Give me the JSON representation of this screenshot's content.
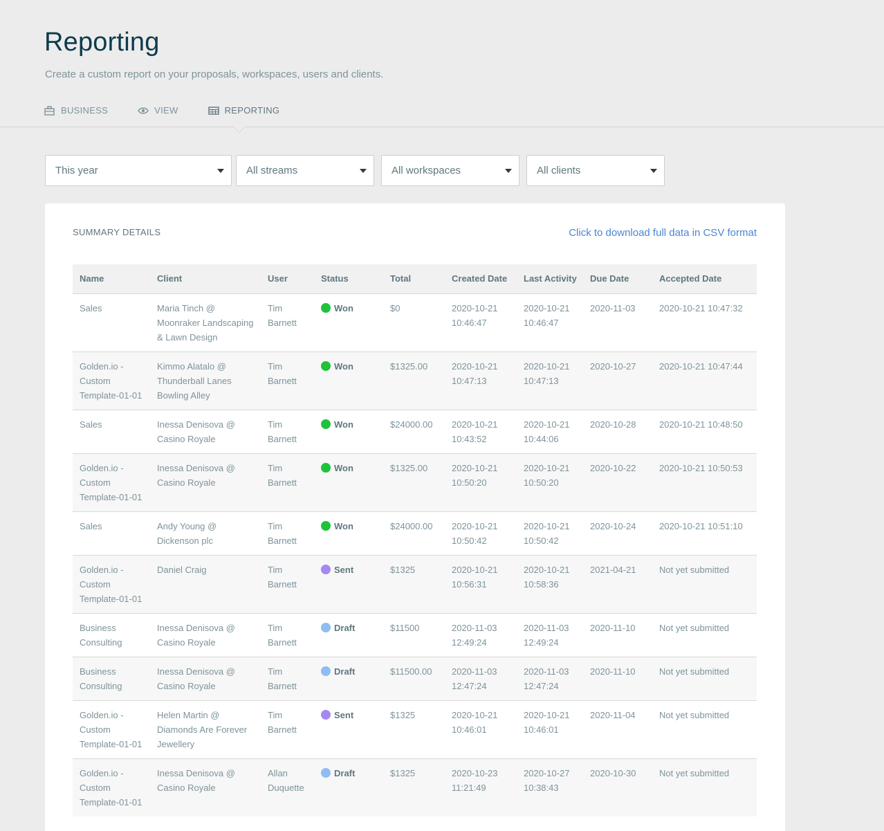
{
  "page": {
    "title": "Reporting",
    "subtitle": "Create a custom report on your proposals, workspaces, users and clients."
  },
  "tabs": [
    {
      "label": "BUSINESS",
      "icon": "briefcase-icon"
    },
    {
      "label": "VIEW",
      "icon": "eye-icon"
    },
    {
      "label": "REPORTING",
      "icon": "table-icon",
      "active": true
    }
  ],
  "filters": {
    "period": "This year",
    "streams": "All streams",
    "workspaces": "All workspaces",
    "clients": "All clients"
  },
  "summary": {
    "title": "SUMMARY DETAILS",
    "csv_link": "Click to download full data in CSV format"
  },
  "table": {
    "columns": [
      "Name",
      "Client",
      "User",
      "Status",
      "Total",
      "Created Date",
      "Last Activity",
      "Due Date",
      "Accepted Date"
    ],
    "status_colors": {
      "Won": "#1fc23c",
      "Sent": "#a48af0",
      "Draft": "#8fbdf2"
    },
    "rows": [
      {
        "name": "Sales",
        "client": "Maria Tinch @ Moonraker Landscaping & Lawn Design",
        "user": "Tim Barnett",
        "status": "Won",
        "total": "$0",
        "created": "2020-10-21 10:46:47",
        "last": "2020-10-21 10:46:47",
        "due": "2020-11-03",
        "accepted": "2020-10-21 10:47:32"
      },
      {
        "name": "Golden.io - Custom Template-01-01",
        "client": "Kimmo Alatalo @ Thunderball Lanes Bowling Alley",
        "user": "Tim Barnett",
        "status": "Won",
        "total": "$1325.00",
        "created": "2020-10-21 10:47:13",
        "last": "2020-10-21 10:47:13",
        "due": "2020-10-27",
        "accepted": "2020-10-21 10:47:44"
      },
      {
        "name": "Sales",
        "client": "Inessa Denisova @ Casino Royale",
        "user": "Tim Barnett",
        "status": "Won",
        "total": "$24000.00",
        "created": "2020-10-21 10:43:52",
        "last": "2020-10-21 10:44:06",
        "due": "2020-10-28",
        "accepted": "2020-10-21 10:48:50"
      },
      {
        "name": "Golden.io - Custom Template-01-01",
        "client": "Inessa Denisova @ Casino Royale",
        "user": "Tim Barnett",
        "status": "Won",
        "total": "$1325.00",
        "created": "2020-10-21 10:50:20",
        "last": "2020-10-21 10:50:20",
        "due": "2020-10-22",
        "accepted": "2020-10-21 10:50:53"
      },
      {
        "name": "Sales",
        "client": "Andy Young @ Dickenson plc",
        "user": "Tim Barnett",
        "status": "Won",
        "total": "$24000.00",
        "created": "2020-10-21 10:50:42",
        "last": "2020-10-21 10:50:42",
        "due": "2020-10-24",
        "accepted": "2020-10-21 10:51:10"
      },
      {
        "name": "Golden.io - Custom Template-01-01",
        "client": "Daniel Craig",
        "user": "Tim Barnett",
        "status": "Sent",
        "total": "$1325",
        "created": "2020-10-21 10:56:31",
        "last": "2020-10-21 10:58:36",
        "due": "2021-04-21",
        "accepted": "Not yet submitted"
      },
      {
        "name": "Business Consulting",
        "client": "Inessa Denisova @ Casino Royale",
        "user": "Tim Barnett",
        "status": "Draft",
        "total": "$11500",
        "created": "2020-11-03 12:49:24",
        "last": "2020-11-03 12:49:24",
        "due": "2020-11-10",
        "accepted": "Not yet submitted"
      },
      {
        "name": "Business Consulting",
        "client": "Inessa Denisova @ Casino Royale",
        "user": "Tim Barnett",
        "status": "Draft",
        "total": "$11500.00",
        "created": "2020-11-03 12:47:24",
        "last": "2020-11-03 12:47:24",
        "due": "2020-11-10",
        "accepted": "Not yet submitted"
      },
      {
        "name": "Golden.io - Custom Template-01-01",
        "client": "Helen Martin @ Diamonds Are Forever Jewellery",
        "user": "Tim Barnett",
        "status": "Sent",
        "total": "$1325",
        "created": "2020-10-21 10:46:01",
        "last": "2020-10-21 10:46:01",
        "due": "2020-11-04",
        "accepted": "Not yet submitted"
      },
      {
        "name": "Golden.io - Custom Template-01-01",
        "client": "Inessa Denisova @ Casino Royale",
        "user": "Allan Duquette",
        "status": "Draft",
        "total": "$1325",
        "created": "2020-10-23 11:21:49",
        "last": "2020-10-27 10:38:43",
        "due": "2020-10-30",
        "accepted": "Not yet submitted"
      }
    ]
  }
}
